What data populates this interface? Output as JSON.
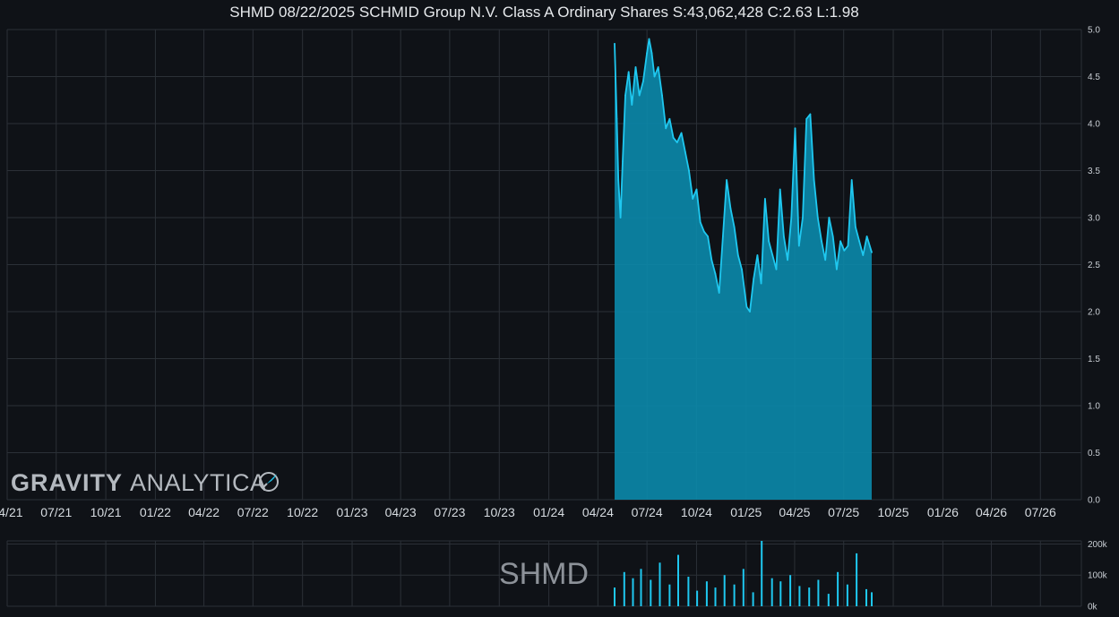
{
  "title": "SHMD 08/22/2025 SCHMID Group N.V. Class A Ordinary Shares S:43,062,428 C:2.63 L:1.98",
  "watermark": {
    "brand_bold": "GRAVITY",
    "brand_light": "ANALYTICA"
  },
  "ticker_label": "SHMD",
  "colors": {
    "background": "#0f1217",
    "line": "#1fc8f0",
    "fill": "#0b8aab",
    "grid": "#2b3037",
    "volume": "#1fc8f0"
  },
  "chart_data": [
    {
      "type": "area",
      "title": "SHMD 08/22/2025 SCHMID Group N.V. Class A Ordinary Shares S:43,062,428 C:2.63 L:1.98",
      "x_tick_labels": [
        "04/21",
        "07/21",
        "10/21",
        "01/22",
        "04/22",
        "07/22",
        "10/22",
        "01/23",
        "04/23",
        "07/23",
        "10/23",
        "01/24",
        "04/24",
        "07/24",
        "10/24",
        "01/25",
        "04/25",
        "07/25",
        "10/25",
        "01/26",
        "04/26",
        "07/26"
      ],
      "y_tick_labels": [
        "0.0",
        "0.5",
        "1.0",
        "1.5",
        "2.0",
        "2.5",
        "3.0",
        "3.5",
        "4.0",
        "4.5",
        "5.0"
      ],
      "ylim": [
        0,
        5
      ],
      "xlim": [
        "2021-04-01",
        "2026-09-15"
      ],
      "grid": true,
      "y_axis_side": "right",
      "x": [
        "2024-05-02",
        "2024-05-06",
        "2024-05-09",
        "2024-05-13",
        "2024-05-17",
        "2024-05-22",
        "2024-05-28",
        "2024-06-03",
        "2024-06-10",
        "2024-06-17",
        "2024-06-24",
        "2024-07-01",
        "2024-07-05",
        "2024-07-10",
        "2024-07-15",
        "2024-07-22",
        "2024-07-29",
        "2024-08-05",
        "2024-08-12",
        "2024-08-19",
        "2024-08-26",
        "2024-09-03",
        "2024-09-10",
        "2024-09-17",
        "2024-09-24",
        "2024-10-01",
        "2024-10-08",
        "2024-10-15",
        "2024-10-22",
        "2024-10-29",
        "2024-11-05",
        "2024-11-12",
        "2024-11-19",
        "2024-11-26",
        "2024-12-03",
        "2024-12-10",
        "2024-12-17",
        "2024-12-24",
        "2025-01-02",
        "2025-01-08",
        "2025-01-15",
        "2025-01-22",
        "2025-01-29",
        "2025-02-05",
        "2025-02-12",
        "2025-02-19",
        "2025-02-26",
        "2025-03-05",
        "2025-03-12",
        "2025-03-19",
        "2025-03-26",
        "2025-04-02",
        "2025-04-09",
        "2025-04-16",
        "2025-04-23",
        "2025-04-30",
        "2025-05-07",
        "2025-05-14",
        "2025-05-21",
        "2025-05-28",
        "2025-06-04",
        "2025-06-11",
        "2025-06-18",
        "2025-06-25",
        "2025-07-02",
        "2025-07-09",
        "2025-07-16",
        "2025-07-23",
        "2025-07-30",
        "2025-08-06",
        "2025-08-13",
        "2025-08-22"
      ],
      "y": [
        4.85,
        4.05,
        3.4,
        3.0,
        3.6,
        4.3,
        4.55,
        4.2,
        4.6,
        4.3,
        4.45,
        4.75,
        4.9,
        4.75,
        4.5,
        4.6,
        4.3,
        3.95,
        4.05,
        3.85,
        3.8,
        3.9,
        3.7,
        3.5,
        3.2,
        3.3,
        2.95,
        2.85,
        2.8,
        2.55,
        2.4,
        2.2,
        2.8,
        3.4,
        3.1,
        2.9,
        2.6,
        2.45,
        2.05,
        2.0,
        2.35,
        2.6,
        2.3,
        3.2,
        2.75,
        2.6,
        2.45,
        3.3,
        2.8,
        2.55,
        3.0,
        3.95,
        2.7,
        3.0,
        4.05,
        4.1,
        3.4,
        3.0,
        2.75,
        2.55,
        3.0,
        2.8,
        2.45,
        2.75,
        2.65,
        2.7,
        3.4,
        2.9,
        2.75,
        2.6,
        2.8,
        2.63
      ],
      "series": [
        {
          "name": "SHMD"
        }
      ]
    },
    {
      "type": "bar",
      "y_tick_labels": [
        "0k",
        "100k",
        "200k"
      ],
      "ylim": [
        0,
        210000
      ],
      "x": [
        "2024-05-02",
        "2024-05-20",
        "2024-06-05",
        "2024-06-20",
        "2024-07-08",
        "2024-07-25",
        "2024-08-12",
        "2024-08-28",
        "2024-09-16",
        "2024-10-02",
        "2024-10-20",
        "2024-11-05",
        "2024-11-22",
        "2024-12-10",
        "2024-12-27",
        "2025-01-14",
        "2025-01-30",
        "2025-02-18",
        "2025-03-06",
        "2025-03-24",
        "2025-04-10",
        "2025-04-28",
        "2025-05-15",
        "2025-06-03",
        "2025-06-20",
        "2025-07-08",
        "2025-07-25",
        "2025-08-12",
        "2025-08-22"
      ],
      "values": [
        60000,
        110000,
        90000,
        120000,
        85000,
        140000,
        70000,
        165000,
        95000,
        50000,
        80000,
        60000,
        100000,
        70000,
        120000,
        45000,
        210000,
        90000,
        80000,
        100000,
        65000,
        60000,
        85000,
        40000,
        110000,
        70000,
        170000,
        55000,
        45000
      ]
    }
  ]
}
